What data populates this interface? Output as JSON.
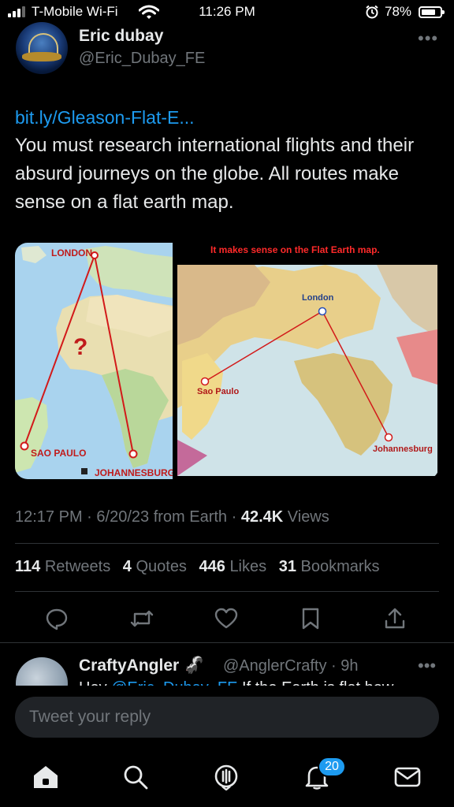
{
  "status_bar": {
    "carrier": "T-Mobile Wi-Fi",
    "time": "11:26 PM",
    "battery": "78%"
  },
  "tweet": {
    "author_name": "Eric dubay",
    "author_handle": "@Eric_Dubay_FE",
    "link": "bit.ly/Gleason-Flat-E...",
    "text": "You must research international flights and their absurd journeys on the globe. All routes make sense on a flat earth map.",
    "media": {
      "left": {
        "labels": {
          "london": "LONDON",
          "sao_paulo": "SAO PAULO",
          "johannesburg": "JOHANNESBURG",
          "question": "?"
        }
      },
      "right": {
        "title": "It makes sense on the Flat Earth map.",
        "labels": {
          "london": "London",
          "sao_paulo": "Sao Paulo",
          "johannesburg": "Johannesburg"
        }
      }
    },
    "meta": {
      "time": "12:17 PM",
      "date": "6/20/23",
      "source": "from Earth",
      "views_count": "42.4K",
      "views_label": "Views"
    },
    "stats": {
      "retweets_count": "114",
      "retweets_label": "Retweets",
      "quotes_count": "4",
      "quotes_label": "Quotes",
      "likes_count": "446",
      "likes_label": "Likes",
      "bookmarks_count": "31",
      "bookmarks_label": "Bookmarks"
    }
  },
  "reply": {
    "author_name": "CraftyAngler",
    "author_handle": "@AnglerCrafty",
    "age": "9h",
    "text_prefix": "Hey ",
    "text_mention": "@Eric_Dubay_FE",
    "text_rest": " If the Earth is flat how"
  },
  "compose": {
    "placeholder": "Tweet your reply"
  },
  "tab_bar": {
    "notifications_badge": "20"
  },
  "icons": {
    "reply": "reply-icon",
    "retweet": "retweet-icon",
    "like": "heart-icon",
    "bookmark": "bookmark-icon",
    "share": "share-icon",
    "home": "home-icon",
    "search": "search-icon",
    "spaces": "spaces-icon",
    "notifications": "bell-icon",
    "messages": "mail-icon"
  },
  "colors": {
    "accent": "#1d9bf0",
    "text": "#e7e9ea",
    "muted": "#71767b",
    "background": "#000000",
    "divider": "#2f3336"
  }
}
